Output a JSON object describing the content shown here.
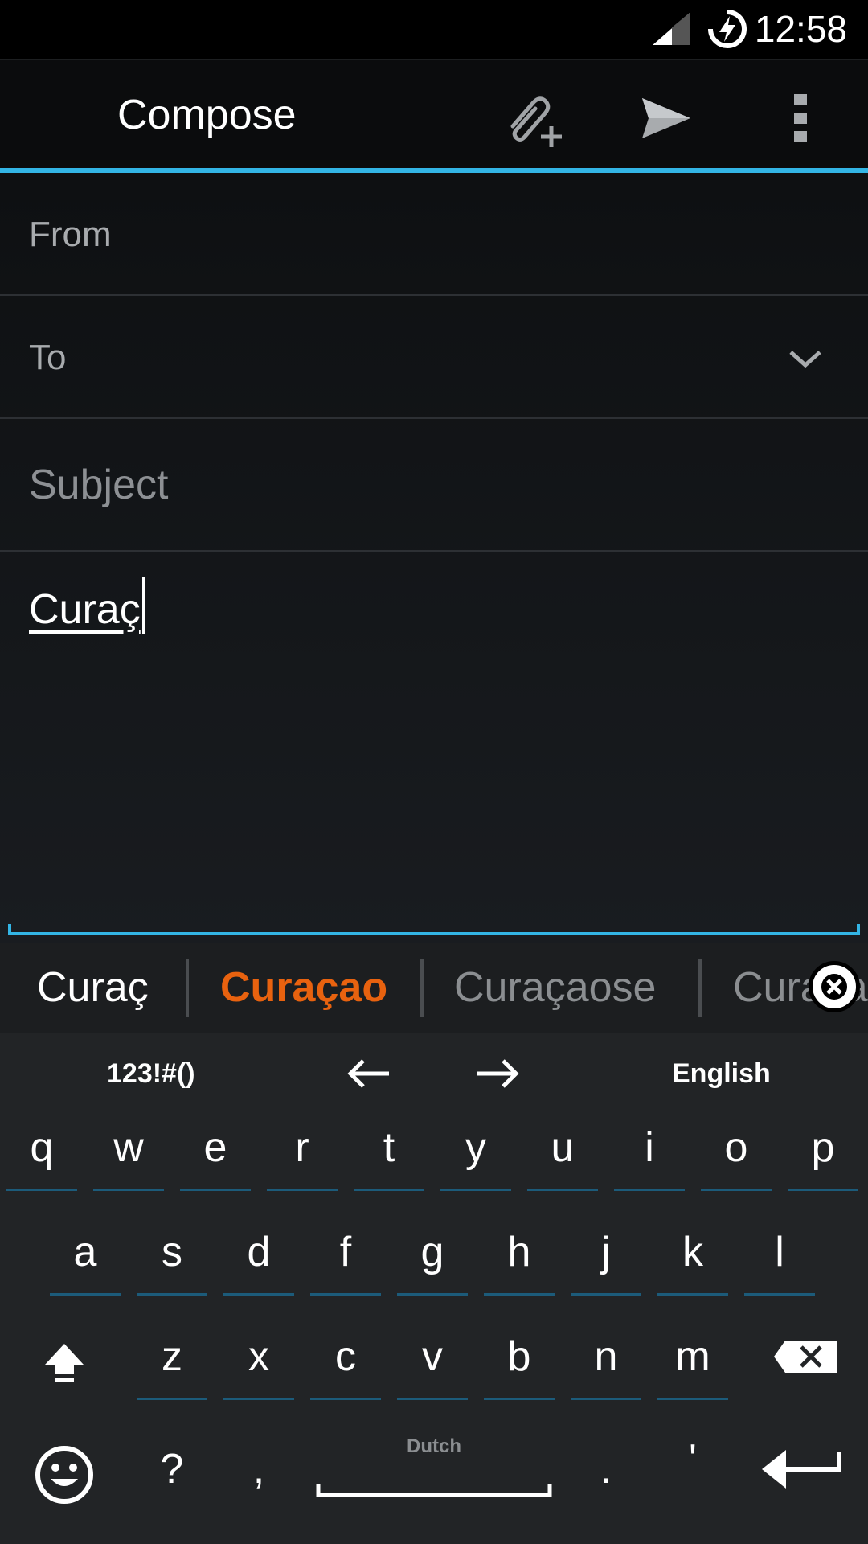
{
  "status_bar": {
    "time": "12:58",
    "signal_icon": "signal-icon",
    "battery_icon": "battery-charging-icon"
  },
  "action_bar": {
    "title": "Compose",
    "attach_icon": "attach-icon",
    "send_icon": "send-icon",
    "overflow_icon": "overflow-menu-icon"
  },
  "compose": {
    "from_label": "From",
    "to_label": "To",
    "subject_placeholder": "Subject",
    "body_text": "Curaç"
  },
  "keyboard": {
    "suggestions": [
      {
        "text": "Curaç",
        "style": "typed"
      },
      {
        "text": "Curaçao",
        "style": "highlight"
      },
      {
        "text": "Curaçaose",
        "style": "dim"
      },
      {
        "text": "Curaçao's",
        "style": "dim"
      }
    ],
    "tools": {
      "symbols_label": "123!#()",
      "language_label": "English",
      "left_arrow_icon": "arrow-left-icon",
      "right_arrow_icon": "arrow-right-icon"
    },
    "row1": [
      "q",
      "w",
      "e",
      "r",
      "t",
      "y",
      "u",
      "i",
      "o",
      "p"
    ],
    "row2": [
      "a",
      "s",
      "d",
      "f",
      "g",
      "h",
      "j",
      "k",
      "l"
    ],
    "row3": [
      "z",
      "x",
      "c",
      "v",
      "b",
      "n",
      "m"
    ],
    "bottom": {
      "question": "?",
      "comma": ",",
      "space_language": "Dutch",
      "period": ".",
      "apostrophe": "'"
    },
    "colors": {
      "accent": "#33b5e5",
      "highlight_suggestion": "#e8620f",
      "dim_suggestion": "#8b8e91"
    }
  }
}
